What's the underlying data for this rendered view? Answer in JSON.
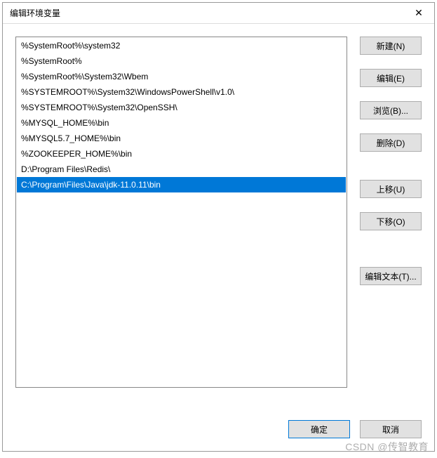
{
  "dialog": {
    "title": "编辑环境变量"
  },
  "list": {
    "items": [
      {
        "value": "%SystemRoot%\\system32",
        "selected": false
      },
      {
        "value": "%SystemRoot%",
        "selected": false
      },
      {
        "value": "%SystemRoot%\\System32\\Wbem",
        "selected": false
      },
      {
        "value": "%SYSTEMROOT%\\System32\\WindowsPowerShell\\v1.0\\",
        "selected": false
      },
      {
        "value": "%SYSTEMROOT%\\System32\\OpenSSH\\",
        "selected": false
      },
      {
        "value": "%MYSQL_HOME%\\bin",
        "selected": false
      },
      {
        "value": "%MYSQL5.7_HOME%\\bin",
        "selected": false
      },
      {
        "value": "%ZOOKEEPER_HOME%\\bin",
        "selected": false
      },
      {
        "value": "D:\\Program Files\\Redis\\",
        "selected": false
      },
      {
        "value": "C:\\Program\\Files\\Java\\jdk-11.0.11\\bin",
        "selected": true
      }
    ]
  },
  "buttons": {
    "new": "新建(N)",
    "edit": "编辑(E)",
    "browse": "浏览(B)...",
    "delete": "删除(D)",
    "moveUp": "上移(U)",
    "moveDown": "下移(O)",
    "editText": "编辑文本(T)...",
    "ok": "确定",
    "cancel": "取消"
  },
  "watermark": "CSDN @传智教育"
}
